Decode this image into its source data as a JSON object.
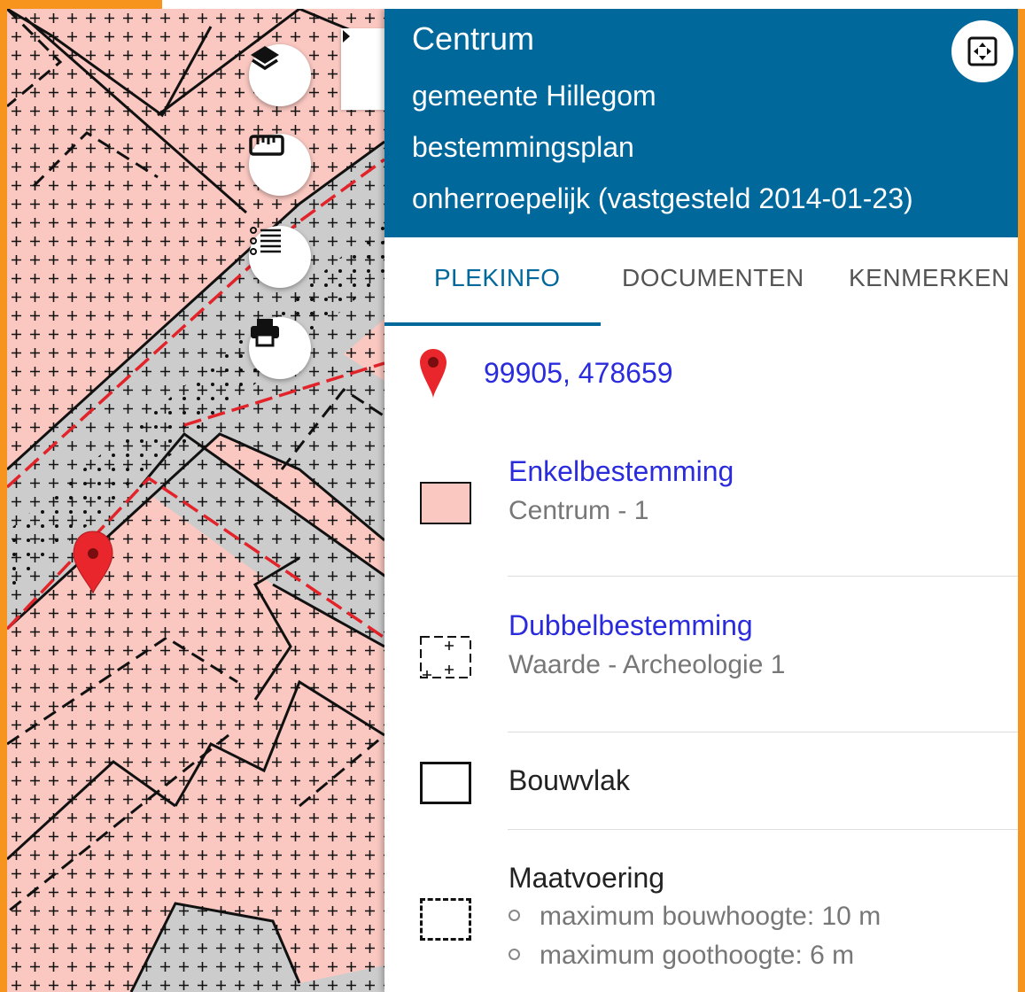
{
  "header": {
    "title": "Centrum",
    "municipality": "gemeente Hillegom",
    "plan_type": "bestemmingsplan",
    "status": "onherroepelijk (vastgesteld 2014-01-23)"
  },
  "tabs": [
    {
      "label": "PLEKINFO",
      "active": true
    },
    {
      "label": "DOCUMENTEN",
      "active": false
    },
    {
      "label": "KENMERKEN",
      "active": false
    }
  ],
  "location": {
    "coordinates": "99905, 478659"
  },
  "items": [
    {
      "title": "Enkelbestemming",
      "subtitle": "Centrum - 1"
    },
    {
      "title": "Dubbelbestemming",
      "subtitle": "Waarde - Archeologie 1"
    },
    {
      "title": "Bouwvlak"
    },
    {
      "title": "Maatvoering",
      "bullets": [
        "maximum bouwhoogte: 10 m",
        "maximum goothoogte: 6 m"
      ]
    }
  ],
  "map_tools": [
    "layers-icon",
    "ruler-icon",
    "legend-list-icon",
    "print-icon"
  ],
  "colors": {
    "header": "#01689b",
    "frame": "#f7941d",
    "centrum_fill": "#fac8c1",
    "road_fill": "#cccccc",
    "link": "#2b2bde",
    "pin": "#e8262b"
  }
}
